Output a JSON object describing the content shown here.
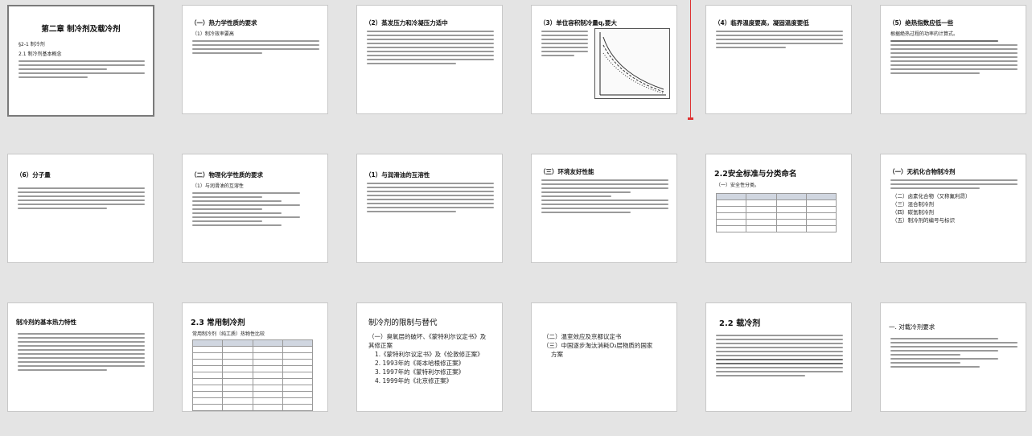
{
  "slides": [
    {
      "title": "第二章  制冷剂及载冷剂",
      "sub1": "§2-1 制冷剂",
      "sub2": "2.1 制冷剂基本概念"
    },
    {
      "title": "（一）热力学性质的要求",
      "sub1": "（1）制冷效率要高"
    },
    {
      "title": "（2）蒸发压力和冷凝压力适中"
    },
    {
      "title": "（3）单位容积制冷量q,要大"
    },
    {
      "title": "（4）临界温度要高，凝固温度要低"
    },
    {
      "title": "（5）绝热指数应低一些",
      "sub1": "根据絶热过程的功率的计算式。"
    },
    {
      "title": "（6）分子量"
    },
    {
      "title": "（二）物理化学性质的要求",
      "sub1": "（1）与润滑油的互溶性"
    },
    {
      "title": "（1）与润滑油的互溶性"
    },
    {
      "title": "（三）环境友好性能"
    },
    {
      "title": "2.2安全标准与分类命名",
      "sub1": "（一）安全性分类。"
    },
    {
      "title": "（一）无机化合物制冷剂",
      "items": [
        "（二）卤素化合物（又称氟利昂）",
        "（三）混合制冷剂",
        "（四）碳氢制冷剂",
        "（五）制冷剂的编号与标识"
      ]
    },
    {
      "title": "制冷剂的基本热力特性"
    },
    {
      "title": "2.3 常用制冷剂",
      "sub1": "常用制冷剂（纯工质）热物性比较"
    },
    {
      "title": "制冷剂的限制与替代",
      "items": [
        "（一）臭氧层的破坏、《蒙特利尔议定书》及",
        "其修正案",
        "1.《蒙特利尔议定书》及《伦敦修正案》",
        "2. 1993年的《哥本哈根修正案》",
        "3. 1997年的《蒙特利尔修正案》",
        "4. 1999年的《北京修正案》"
      ]
    },
    {
      "title": "",
      "items": [
        "（二）温室效应及京都议定书",
        "（三）中国逐步淘汰消耗O₃层物质的国家",
        "方案"
      ]
    },
    {
      "title": "2.2 载冷剂"
    },
    {
      "title": "一. 对载冷剂要求"
    }
  ]
}
